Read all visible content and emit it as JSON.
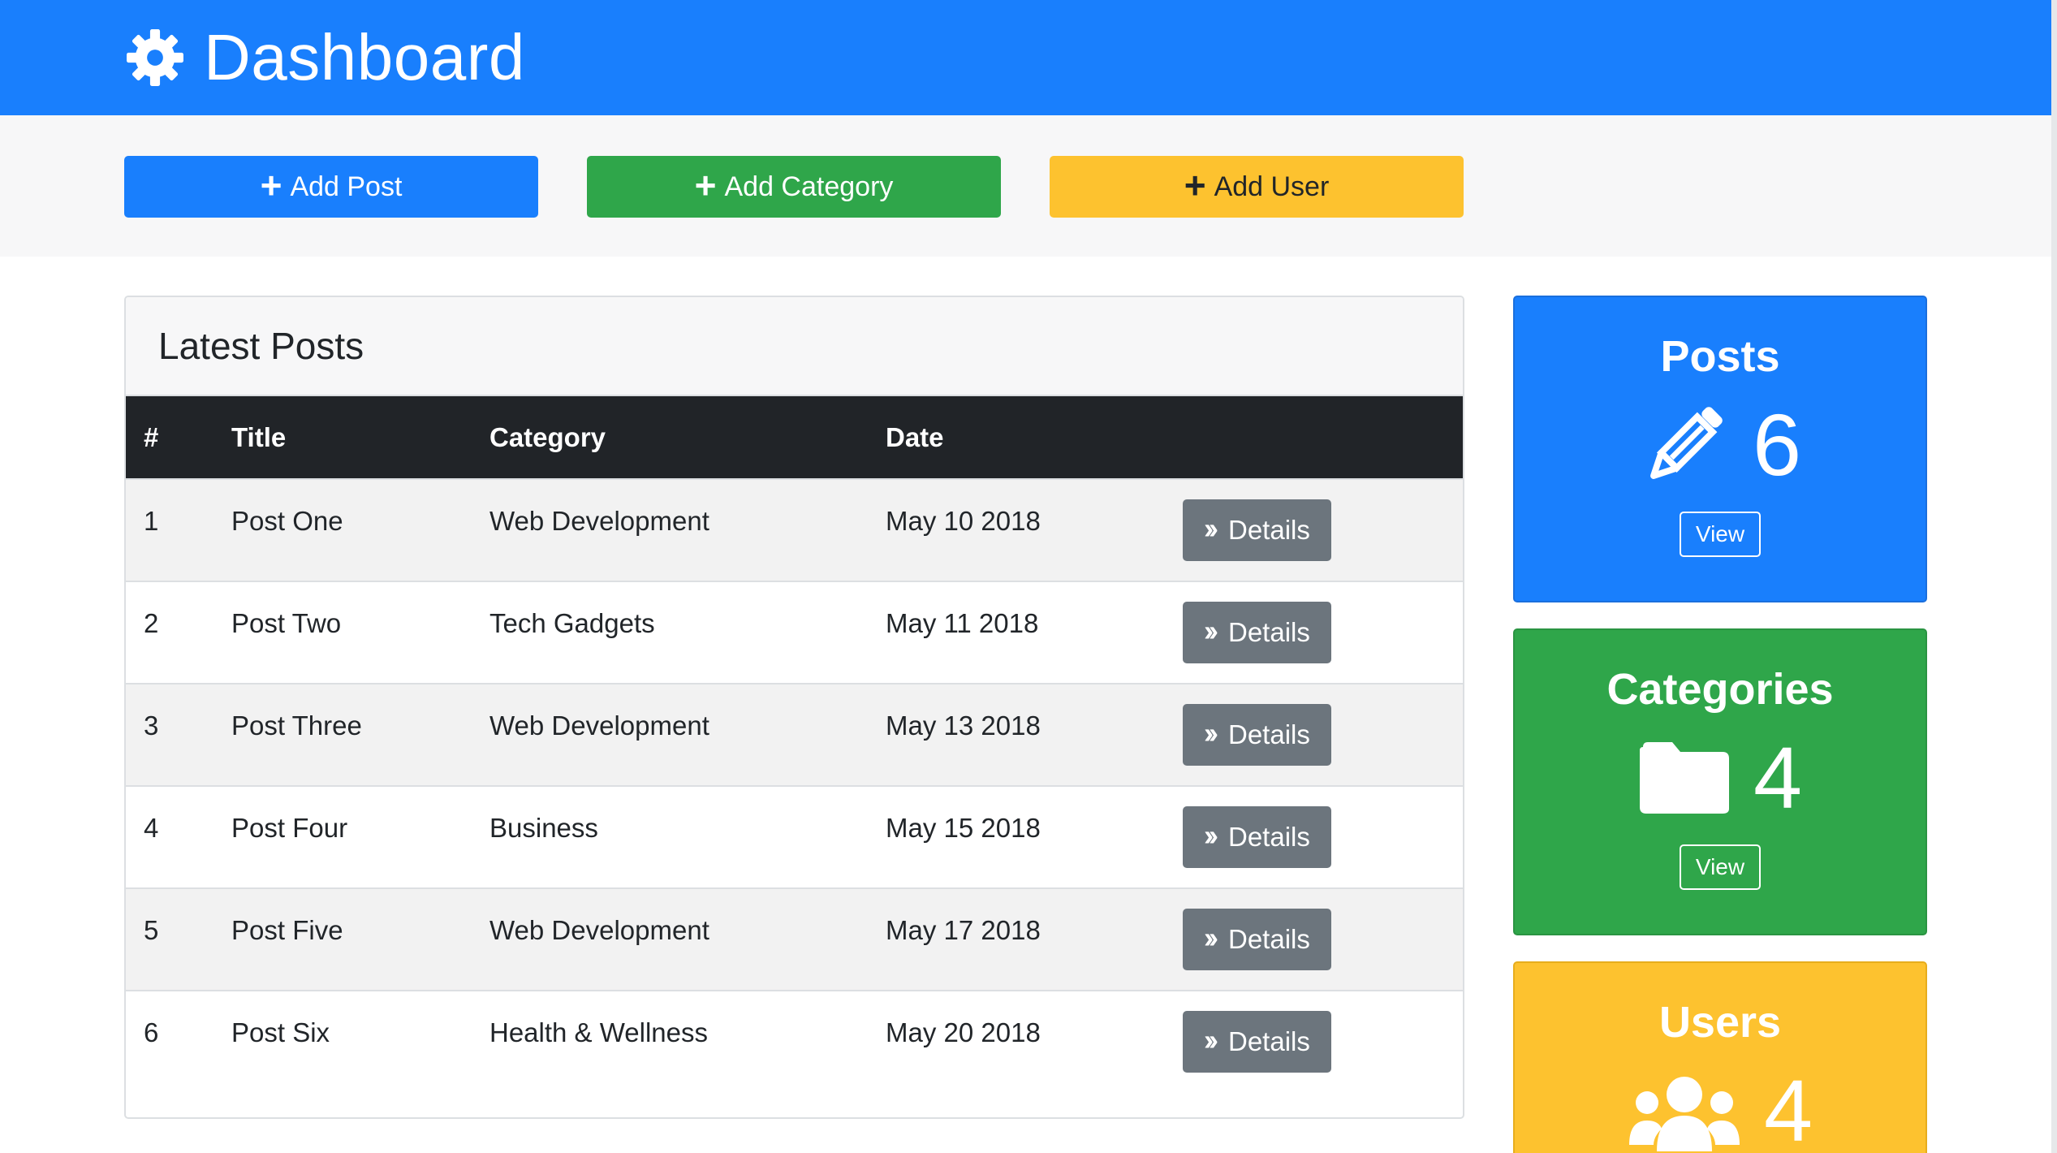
{
  "header": {
    "title": "Dashboard",
    "icon": "gear-icon"
  },
  "actions": {
    "add_post": "Add Post",
    "add_category": "Add Category",
    "add_user": "Add User"
  },
  "latest_posts": {
    "title": "Latest Posts",
    "columns": [
      "#",
      "Title",
      "Category",
      "Date"
    ],
    "rows": [
      {
        "num": "1",
        "title": "Post One",
        "category": "Web Development",
        "date": "May 10 2018",
        "action": "Details"
      },
      {
        "num": "2",
        "title": "Post Two",
        "category": "Tech Gadgets",
        "date": "May 11 2018",
        "action": "Details"
      },
      {
        "num": "3",
        "title": "Post Three",
        "category": "Web Development",
        "date": "May 13 2018",
        "action": "Details"
      },
      {
        "num": "4",
        "title": "Post Four",
        "category": "Business",
        "date": "May 15 2018",
        "action": "Details"
      },
      {
        "num": "5",
        "title": "Post Five",
        "category": "Web Development",
        "date": "May 17 2018",
        "action": "Details"
      },
      {
        "num": "6",
        "title": "Post Six",
        "category": "Health & Wellness",
        "date": "May 20 2018",
        "action": "Details"
      }
    ]
  },
  "stats": {
    "posts": {
      "title": "Posts",
      "count": "6",
      "view": "View",
      "icon": "pencil-icon"
    },
    "categories": {
      "title": "Categories",
      "count": "4",
      "view": "View",
      "icon": "folder-icon"
    },
    "users": {
      "title": "Users",
      "count": "4",
      "icon": "users-icon"
    }
  },
  "colors": {
    "primary": "#197ffd",
    "success": "#2fa64a",
    "warning": "#fdc22f",
    "dark": "#212428",
    "secondary": "#6c757d"
  }
}
